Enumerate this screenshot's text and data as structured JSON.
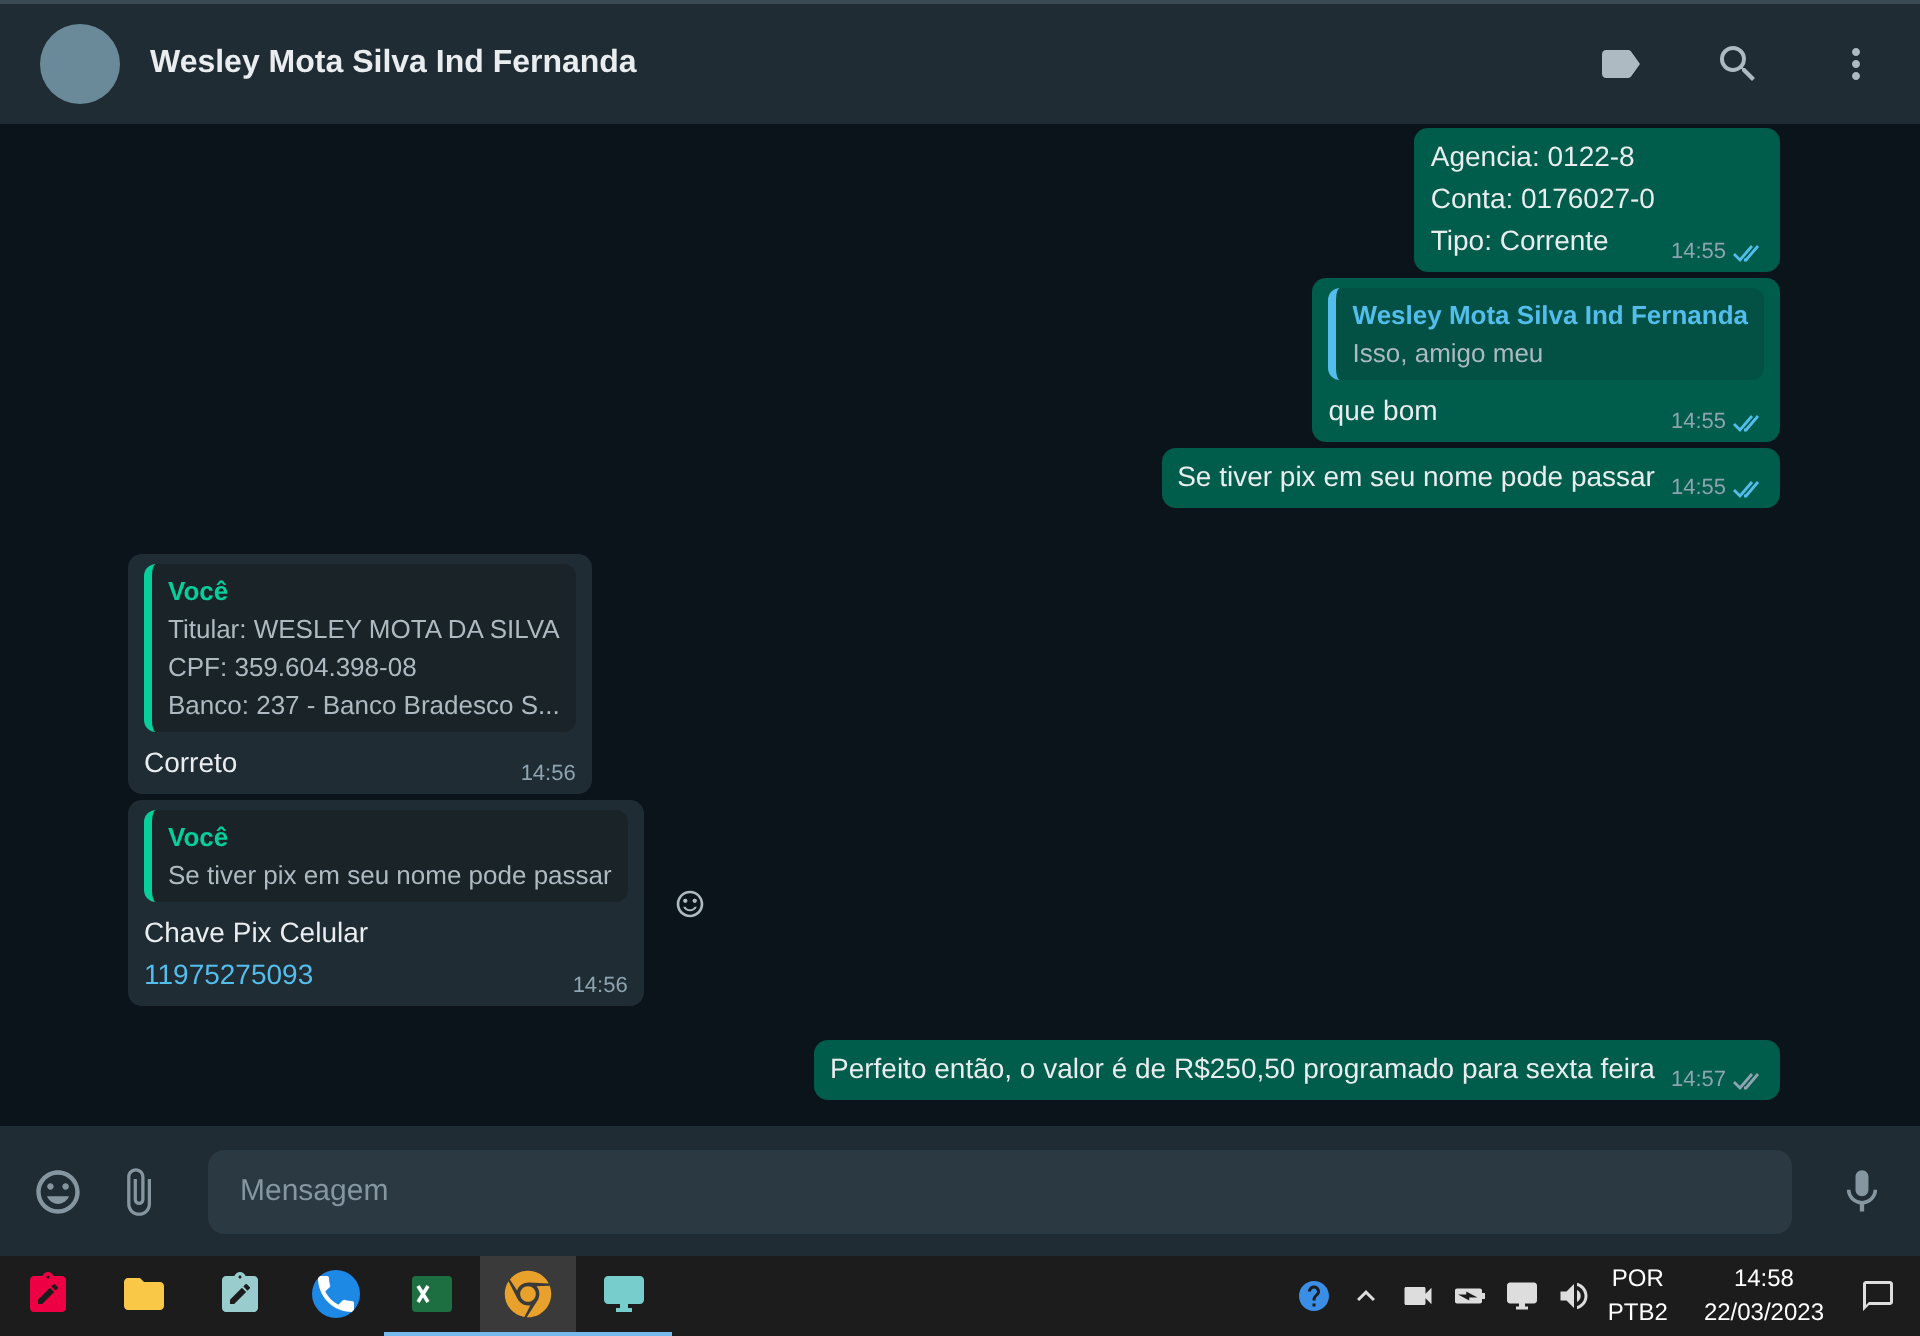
{
  "header": {
    "title": "Wesley Mota Silva Ind Fernanda"
  },
  "messages": [
    {
      "kind": "out",
      "lines": [
        {
          "kind": "text",
          "text": "Agencia: 0122-8"
        },
        {
          "kind": "text",
          "text": "Conta: 0176027-0"
        },
        {
          "kind": "text",
          "text": "Tipo: Corrente"
        }
      ],
      "time": "14:55",
      "read": true
    },
    {
      "kind": "out",
      "quote": {
        "author": "Wesley Mota Silva Ind Fernanda",
        "lines": [
          "Isso, amigo meu"
        ]
      },
      "lines": [
        {
          "kind": "text",
          "text": "que bom"
        }
      ],
      "time": "14:55",
      "read": true
    },
    {
      "kind": "out",
      "lines": [
        {
          "kind": "text",
          "text": "Se tiver pix em seu nome pode passar"
        }
      ],
      "time": "14:55",
      "read": true
    },
    {
      "kind": "in",
      "quote": {
        "author": "Você",
        "lines": [
          "Titular: WESLEY MOTA DA SILVA",
          "CPF: 359.604.398-08",
          "Banco: 237 - Banco Bradesco S..."
        ]
      },
      "lines": [
        {
          "kind": "text",
          "text": "Correto"
        }
      ],
      "time": "14:56"
    },
    {
      "kind": "in",
      "quote": {
        "author": "Você",
        "lines": [
          "Se tiver pix em seu nome pode passar"
        ]
      },
      "lines": [
        {
          "kind": "text",
          "text": "Chave Pix Celular"
        },
        {
          "kind": "link",
          "text": "11975275093"
        }
      ],
      "time": "14:56",
      "react": true
    },
    {
      "kind": "out",
      "lines": [
        {
          "kind": "text",
          "text": "Perfeito então, o valor é de R$250,50 programado para sexta feira"
        }
      ],
      "time": "14:57",
      "read": false
    }
  ],
  "composer": {
    "placeholder": "Mensagem"
  },
  "taskbar": {
    "apps": [
      {
        "kind": "snip",
        "selected": false,
        "running": false
      },
      {
        "kind": "folder",
        "selected": false,
        "running": false
      },
      {
        "kind": "notepad",
        "selected": false,
        "running": false
      },
      {
        "kind": "phone",
        "selected": false,
        "running": false
      },
      {
        "kind": "excel",
        "selected": false,
        "running": true
      },
      {
        "kind": "chrome",
        "selected": true,
        "running": true
      },
      {
        "kind": "news",
        "selected": false,
        "running": true
      }
    ],
    "language": [
      "POR",
      "PTB2"
    ],
    "time": "14:58",
    "date": "22/03/2023"
  }
}
